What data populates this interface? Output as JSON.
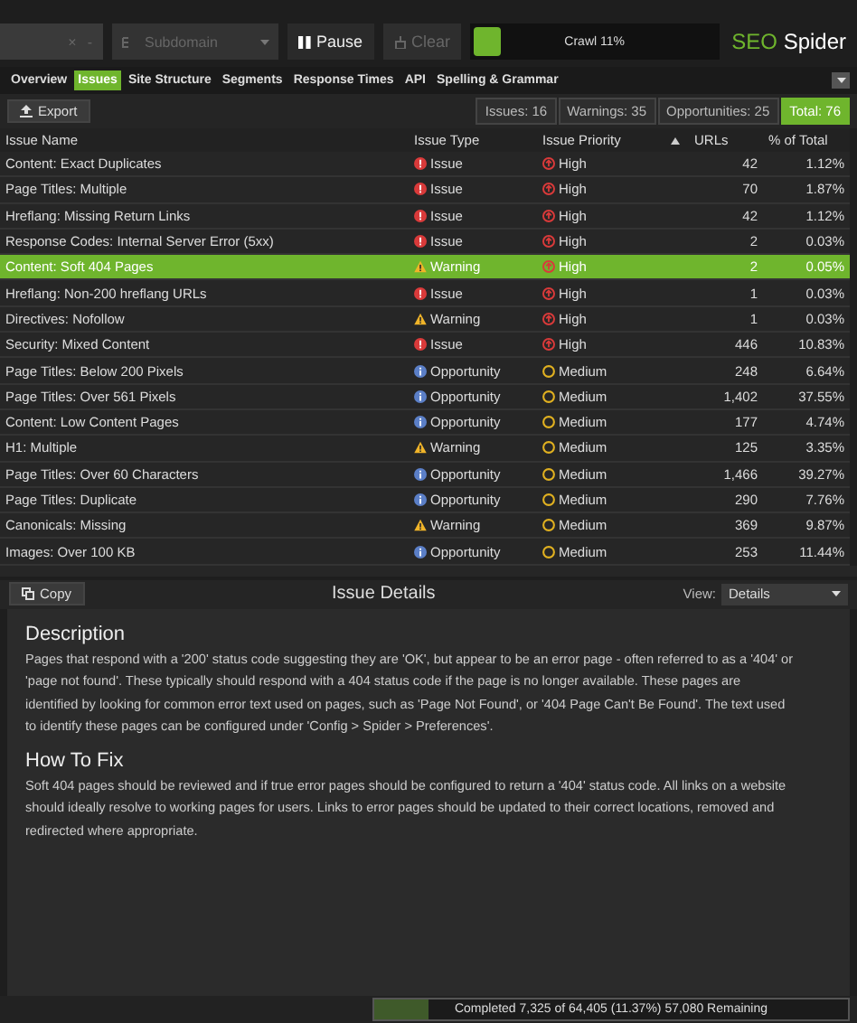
{
  "toolbar": {
    "url_field": {
      "clear": "×",
      "menu": "-"
    },
    "mode_dropdown": {
      "value": "Subdomain"
    },
    "pause_button": "Pause",
    "clear_button": "Clear",
    "crawl_progress": {
      "level": 0.11,
      "label": "Crawl 11%"
    },
    "logo": {
      "brand": "SEO",
      "product": "Spider"
    }
  },
  "tabs": [
    {
      "label": "Overview",
      "selected": false
    },
    {
      "label": "Issues",
      "selected": true
    },
    {
      "label": "Site Structure",
      "selected": false
    },
    {
      "label": "Segments",
      "selected": false
    },
    {
      "label": "Response Times",
      "selected": false
    },
    {
      "label": "API",
      "selected": false
    },
    {
      "label": "Spelling & Grammar",
      "selected": false
    }
  ],
  "export_button": "Export",
  "summary": [
    {
      "label": "Issues: 16",
      "selected": false
    },
    {
      "label": "Warnings: 35",
      "selected": false
    },
    {
      "label": "Opportunities: 25",
      "selected": false
    },
    {
      "label": "Total: 76",
      "selected": true
    }
  ],
  "table": {
    "columns": [
      "Issue Name",
      "Issue Type",
      "Issue Priority",
      "URLs",
      "% of Total"
    ],
    "rows": [
      {
        "name": "Content: Exact Duplicates",
        "type": {
          "kind": "issue",
          "label": "Issue"
        },
        "priority": {
          "kind": "high",
          "label": "High"
        },
        "urls": "42",
        "percent": "1.12%",
        "selected": false
      },
      {
        "name": "Page Titles: Multiple",
        "type": {
          "kind": "issue",
          "label": "Issue"
        },
        "priority": {
          "kind": "high",
          "label": "High"
        },
        "urls": "70",
        "percent": "1.87%",
        "selected": false
      },
      {
        "name": "Hreflang: Missing Return Links",
        "type": {
          "kind": "issue",
          "label": "Issue"
        },
        "priority": {
          "kind": "high",
          "label": "High"
        },
        "urls": "42",
        "percent": "1.12%",
        "selected": false
      },
      {
        "name": "Response Codes: Internal Server Error (5xx)",
        "type": {
          "kind": "issue",
          "label": "Issue"
        },
        "priority": {
          "kind": "high",
          "label": "High"
        },
        "urls": "2",
        "percent": "0.03%",
        "selected": false
      },
      {
        "name": "Content: Soft 404 Pages",
        "type": {
          "kind": "warning",
          "label": "Warning"
        },
        "priority": {
          "kind": "high",
          "label": "High"
        },
        "urls": "2",
        "percent": "0.05%",
        "selected": true
      },
      {
        "name": "Hreflang: Non-200 hreflang URLs",
        "type": {
          "kind": "issue",
          "label": "Issue"
        },
        "priority": {
          "kind": "high",
          "label": "High"
        },
        "urls": "1",
        "percent": "0.03%",
        "selected": false
      },
      {
        "name": "Directives: Nofollow",
        "type": {
          "kind": "warning",
          "label": "Warning"
        },
        "priority": {
          "kind": "high",
          "label": "High"
        },
        "urls": "1",
        "percent": "0.03%",
        "selected": false
      },
      {
        "name": "Security: Mixed Content",
        "type": {
          "kind": "issue",
          "label": "Issue"
        },
        "priority": {
          "kind": "high",
          "label": "High"
        },
        "urls": "446",
        "percent": "10.83%",
        "selected": false
      },
      {
        "name": "Page Titles: Below 200 Pixels",
        "type": {
          "kind": "opportunity",
          "label": "Opportunity"
        },
        "priority": {
          "kind": "medium",
          "label": "Medium"
        },
        "urls": "248",
        "percent": "6.64%",
        "selected": false
      },
      {
        "name": "Page Titles: Over 561 Pixels",
        "type": {
          "kind": "opportunity",
          "label": "Opportunity"
        },
        "priority": {
          "kind": "medium",
          "label": "Medium"
        },
        "urls": "1,402",
        "percent": "37.55%",
        "selected": false
      },
      {
        "name": "Content: Low Content Pages",
        "type": {
          "kind": "opportunity",
          "label": "Opportunity"
        },
        "priority": {
          "kind": "medium",
          "label": "Medium"
        },
        "urls": "177",
        "percent": "4.74%",
        "selected": false
      },
      {
        "name": "H1: Multiple",
        "type": {
          "kind": "warning",
          "label": "Warning"
        },
        "priority": {
          "kind": "medium",
          "label": "Medium"
        },
        "urls": "125",
        "percent": "3.35%",
        "selected": false
      },
      {
        "name": "Page Titles: Over 60 Characters",
        "type": {
          "kind": "opportunity",
          "label": "Opportunity"
        },
        "priority": {
          "kind": "medium",
          "label": "Medium"
        },
        "urls": "1,466",
        "percent": "39.27%",
        "selected": false
      },
      {
        "name": "Page Titles: Duplicate",
        "type": {
          "kind": "opportunity",
          "label": "Opportunity"
        },
        "priority": {
          "kind": "medium",
          "label": "Medium"
        },
        "urls": "290",
        "percent": "7.76%",
        "selected": false
      },
      {
        "name": "Canonicals: Missing",
        "type": {
          "kind": "warning",
          "label": "Warning"
        },
        "priority": {
          "kind": "medium",
          "label": "Medium"
        },
        "urls": "369",
        "percent": "9.87%",
        "selected": false
      },
      {
        "name": "Images: Over 100 KB",
        "type": {
          "kind": "opportunity",
          "label": "Opportunity"
        },
        "priority": {
          "kind": "medium",
          "label": "Medium"
        },
        "urls": "253",
        "percent": "11.44%",
        "selected": false
      }
    ]
  },
  "details": {
    "copy_button": "Copy",
    "title": "Issue Details",
    "view_label": "View:",
    "view_dropdown": "Details",
    "sections": [
      {
        "heading": "Description",
        "text": "Pages that respond with a '200' status code suggesting they are 'OK', but appear to be an error page - often referred to as a '404' or 'page not found'. These typically should respond with a 404 status code if the page is no longer available. These pages are identified by looking for common error text used on pages, such as 'Page Not Found', or '404 Page Can't Be Found'. The text used to identify these pages can be configured under 'Config > Spider > Preferences'."
      },
      {
        "heading": "How To Fix",
        "text": "Soft 404 pages should be reviewed and if true error pages should be configured to return a '404' status code. All links on a website should ideally resolve to working pages for users. Links to error pages should be updated to their correct locations, removed and redirected where appropriate."
      }
    ]
  },
  "status_bar": {
    "level": 0.1137,
    "label": "Completed 7,325 of 64,405 (11.37%) 57,080 Remaining"
  }
}
